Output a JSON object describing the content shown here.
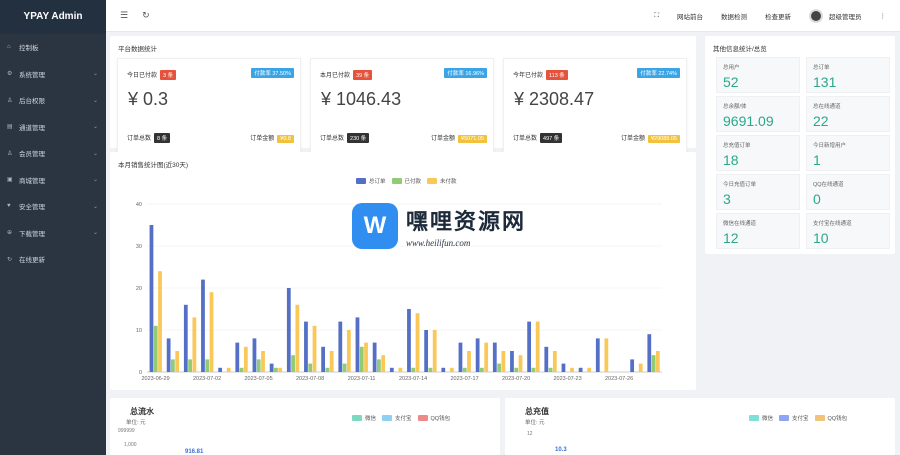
{
  "sidebar": {
    "brand": "YPAY Admin",
    "items": [
      {
        "icon": "home-icon",
        "glyph": "⌂",
        "label": "控制板",
        "has_children": false
      },
      {
        "icon": "gear-icon",
        "glyph": "⚙",
        "label": "系统管理",
        "has_children": true
      },
      {
        "icon": "user-icon",
        "glyph": "♙",
        "label": "后台权限",
        "has_children": true
      },
      {
        "icon": "channel-icon",
        "glyph": "▤",
        "label": "通道管理",
        "has_children": true
      },
      {
        "icon": "member-icon",
        "glyph": "♙",
        "label": "会员管理",
        "has_children": true
      },
      {
        "icon": "shop-icon",
        "glyph": "▣",
        "label": "商城管理",
        "has_children": true
      },
      {
        "icon": "shield-icon",
        "glyph": "♥",
        "label": "安全管理",
        "has_children": true
      },
      {
        "icon": "download-icon",
        "glyph": "⊕",
        "label": "下载管理",
        "has_children": true
      },
      {
        "icon": "refresh-icon",
        "glyph": "↻",
        "label": "在线更新",
        "has_children": false
      }
    ]
  },
  "topbar": {
    "links": [
      "网站前台",
      "数据检测",
      "检查更新"
    ],
    "user_name": "超级管理员"
  },
  "stats_panel": {
    "title": "平台数据统计",
    "cards": [
      {
        "label": "今日已付款",
        "count": "3 条",
        "rate": "付款率 37.50%",
        "value": "¥ 0.3",
        "total_orders_label": "订单总数",
        "total_orders": "8 条",
        "total_amount_label": "订单金额",
        "total_amount": "¥0.8"
      },
      {
        "label": "本月已付款",
        "count": "39 条",
        "rate": "付款率 16.96%",
        "value": "¥ 1046.43",
        "total_orders_label": "订单总数",
        "total_orders": "230 条",
        "total_amount_label": "订单金额",
        "total_amount": "¥5071.05"
      },
      {
        "label": "今年已付款",
        "count": "113 条",
        "rate": "付款率 22.74%",
        "value": "¥ 2308.47",
        "total_orders_label": "订单总数",
        "total_orders": "497 条",
        "total_amount_label": "订单金额",
        "total_amount": "¥29089.05"
      }
    ]
  },
  "other_stats": {
    "title": "其他信息统计/总览",
    "items": [
      {
        "label": "总用户",
        "value": "52"
      },
      {
        "label": "总订单",
        "value": "131"
      },
      {
        "label": "总余额/体",
        "value": "9691.09"
      },
      {
        "label": "总在线通道",
        "value": "22"
      },
      {
        "label": "总充值订单",
        "value": "18"
      },
      {
        "label": "今日新增用户",
        "value": "1"
      },
      {
        "label": "今日充值订单",
        "value": "3"
      },
      {
        "label": "QQ在线通道",
        "value": "0"
      },
      {
        "label": "微信在线通道",
        "value": "12"
      },
      {
        "label": "支付宝在线通道",
        "value": "10"
      }
    ]
  },
  "chart_data": {
    "type": "bar",
    "title": "本月销售统计图(近30天)",
    "xlabel": "",
    "ylabel": "",
    "ylim": [
      0,
      40
    ],
    "yticks": [
      0,
      10,
      20,
      30,
      40
    ],
    "x_tick_labels": [
      "2023-06-29",
      "2023-07-02",
      "2023-07-05",
      "2023-07-08",
      "2023-07-11",
      "2023-07-14",
      "2023-07-17",
      "2023-07-20",
      "2023-07-23",
      "2023-07-26"
    ],
    "legend_position": "top-center",
    "series": [
      {
        "name": "总订单",
        "color": "#5470c6",
        "values": [
          35,
          8,
          16,
          22,
          1,
          7,
          8,
          2,
          20,
          12,
          6,
          12,
          13,
          7,
          1,
          15,
          10,
          1,
          7,
          8,
          7,
          5,
          12,
          6,
          2,
          1,
          8,
          0,
          3,
          9
        ]
      },
      {
        "name": "已付款",
        "color": "#91cc75",
        "values": [
          11,
          3,
          3,
          3,
          0,
          1,
          3,
          1,
          4,
          2,
          1,
          2,
          6,
          3,
          0,
          1,
          1,
          0,
          1,
          1,
          2,
          1,
          1,
          1,
          0,
          0,
          0,
          0,
          0,
          4
        ]
      },
      {
        "name": "未付款",
        "color": "#fac858",
        "values": [
          24,
          5,
          13,
          19,
          1,
          6,
          5,
          1,
          16,
          11,
          5,
          10,
          7,
          4,
          1,
          14,
          10,
          1,
          5,
          7,
          5,
          4,
          12,
          5,
          1,
          1,
          8,
          0,
          2,
          5
        ]
      }
    ]
  },
  "flow_panel": {
    "title": "总流水",
    "unit": "单位: 元",
    "legend": [
      {
        "name": "微信",
        "color": "#7dd8c0"
      },
      {
        "name": "支付宝",
        "color": "#8fd0f0"
      },
      {
        "name": "QQ钱包",
        "color": "#ef8a8a"
      }
    ],
    "y_top_label": "999999",
    "y_label": "1,000",
    "value_label": "916.81"
  },
  "recharge_panel": {
    "title": "总充值",
    "unit": "单位: 元",
    "legend": [
      {
        "name": "微信",
        "color": "#7ee0d6"
      },
      {
        "name": "支付宝",
        "color": "#8ea6f5"
      },
      {
        "name": "QQ钱包",
        "color": "#f3c27a"
      }
    ],
    "y_label": "12",
    "value_label": "10.3"
  },
  "watermark": {
    "name": "嘿哩资源网",
    "url": "www.heilifun.com"
  }
}
